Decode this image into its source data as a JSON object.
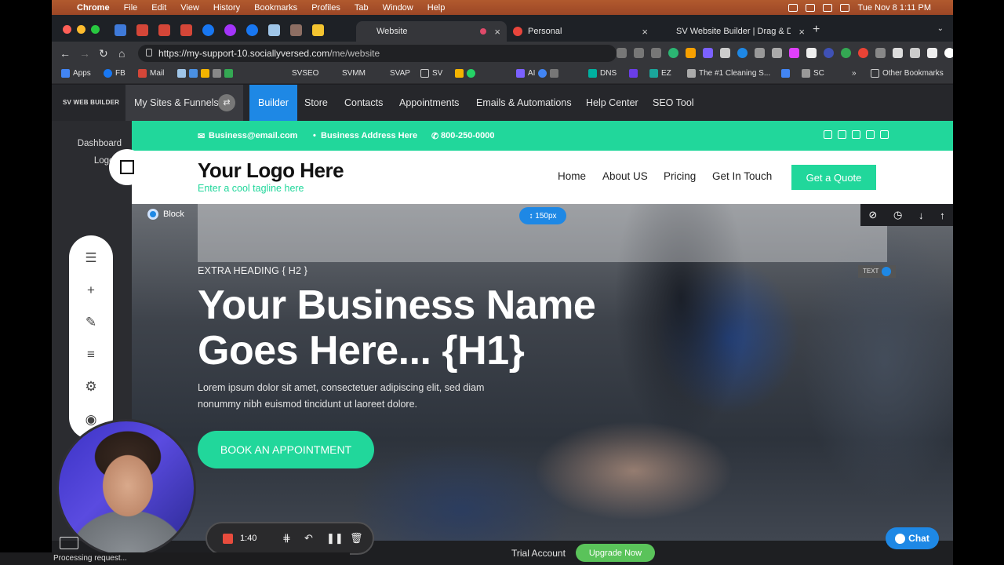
{
  "menubar": {
    "items": [
      "Chrome",
      "File",
      "Edit",
      "View",
      "History",
      "Bookmarks",
      "Profiles",
      "Tab",
      "Window",
      "Help"
    ],
    "clock": "Tue Nov 8  1:11 PM"
  },
  "tabs": [
    {
      "label": "Website"
    },
    {
      "label": "Personal"
    },
    {
      "label": "SV Website Builder | Drag & Dr"
    }
  ],
  "address": {
    "host": "https://my-support-10.sociallyversed.com",
    "path": "/me/website"
  },
  "bookmarks": [
    "Apps",
    "FB",
    "Mail",
    "SVSEO",
    "SVMM",
    "SVAP",
    "SV",
    "AI",
    "DNS",
    "EZ",
    "The #1 Cleaning S...",
    "SC",
    "»",
    "Other Bookmarks"
  ],
  "builder_nav": {
    "brand": "SV WEB BUILDER",
    "my_sites": "My Sites & Funnels",
    "items": [
      "Builder",
      "Store",
      "Contacts",
      "Appointments",
      "Emails & Automations",
      "Help Center",
      "SEO Tool"
    ]
  },
  "sidebar": {
    "dashboard": "Dashboard",
    "logout": "Logout"
  },
  "site": {
    "email": "Business@email.com",
    "address": "Business Address Here",
    "phone": "800-250-0000",
    "logo": "Your Logo Here",
    "tagline": "Enter a cool tagline here",
    "menu": [
      "Home",
      "About US",
      "Pricing",
      "Get In Touch"
    ],
    "cta": "Get a Quote",
    "block_label": "Block",
    "spacing_badge": "150px",
    "text_tag": "TEXT",
    "extra_heading": "EXTRA HEADING { H2 }",
    "h1": "Your Business Name Goes Here... {H1}",
    "lorem": "Lorem ipsum dolor sit amet, consectetuer adipiscing elit, sed diam nonummy nibh euismod tincidunt ut laoreet dolore.",
    "book_button": "BOOK AN APPOINTMENT"
  },
  "footer_bar": {
    "trial": "Trial Account",
    "upgrade": "Upgrade Now",
    "chat": "Chat"
  },
  "recorder": {
    "time": "1:40"
  },
  "status": "Processing request...",
  "colors": {
    "accent": "#21d79b",
    "builder_blue": "#1e88e5",
    "upgrade_green": "#5ac35a"
  }
}
